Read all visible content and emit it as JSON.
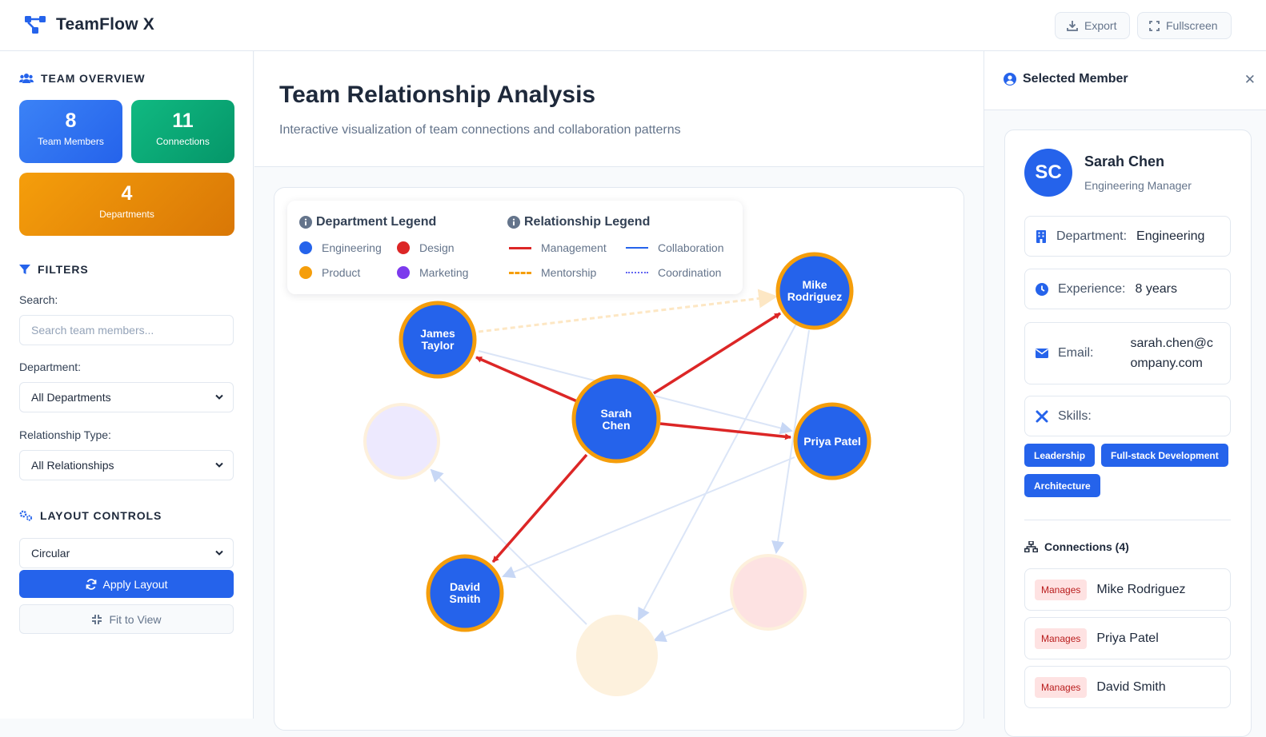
{
  "app": {
    "title": "TeamFlow X"
  },
  "toolbar": {
    "export_label": "Export",
    "fullscreen_label": "Fullscreen"
  },
  "sidebar": {
    "overview_title": "TEAM OVERVIEW",
    "stats": [
      {
        "value": "8",
        "label": "Team Members",
        "color": "#2563eb"
      },
      {
        "value": "11",
        "label": "Connections",
        "color": "#10b981"
      },
      {
        "value": "4",
        "label": "Departments",
        "color": "#f59e0b"
      }
    ],
    "filters_title": "FILTERS",
    "search_label": "Search:",
    "search_placeholder": "Search team members...",
    "department_label": "Department:",
    "department_value": "All Departments",
    "relationship_label": "Relationship Type:",
    "relationship_value": "All Relationships",
    "layout_title": "LAYOUT CONTROLS",
    "layout_value": "Circular",
    "apply_label": "Apply Layout",
    "fit_label": "Fit to View"
  },
  "main": {
    "title": "Team Relationship Analysis",
    "subtitle": "Interactive visualization of team connections and collaboration patterns"
  },
  "legend": {
    "department_title": "Department Legend",
    "relationship_title": "Relationship Legend",
    "departments": [
      {
        "label": "Engineering",
        "color": "#2563eb"
      },
      {
        "label": "Design",
        "color": "#dc2626"
      },
      {
        "label": "Product",
        "color": "#f59e0b"
      },
      {
        "label": "Marketing",
        "color": "#7c3aed"
      }
    ],
    "relationships": [
      {
        "label": "Management",
        "color": "#dc2626",
        "style": "solid-thick"
      },
      {
        "label": "Collaboration",
        "color": "#2563eb",
        "style": "solid"
      },
      {
        "label": "Mentorship",
        "color": "#f59e0b",
        "style": "dashed"
      },
      {
        "label": "Coordination",
        "color": "#6366f1",
        "style": "dotted"
      }
    ]
  },
  "graph": {
    "nodes": [
      {
        "id": "sarah",
        "line1": "Sarah",
        "line2": "Chen",
        "dept": "Engineering",
        "faded": false
      },
      {
        "id": "mike",
        "line1": "Mike",
        "line2": "Rodriguez",
        "dept": "Engineering",
        "faded": false
      },
      {
        "id": "james",
        "line1": "James",
        "line2": "Taylor",
        "dept": "Engineering",
        "faded": false
      },
      {
        "id": "priya",
        "line1": "Priya Patel",
        "line2": "",
        "dept": "Engineering",
        "faded": false
      },
      {
        "id": "david",
        "line1": "David",
        "line2": "Smith",
        "dept": "Engineering",
        "faded": false
      },
      {
        "id": "marketing",
        "line1": "",
        "line2": "",
        "dept": "Marketing",
        "faded": true
      },
      {
        "id": "design",
        "line1": "",
        "line2": "",
        "dept": "Design",
        "faded": true
      },
      {
        "id": "product",
        "line1": "",
        "line2": "",
        "dept": "Product",
        "faded": true
      }
    ]
  },
  "panel": {
    "title": "Selected Member",
    "member": {
      "initials": "SC",
      "name": "Sarah Chen",
      "role": "Engineering Manager",
      "department_key": "Department:",
      "department": "Engineering",
      "experience_key": "Experience:",
      "experience": "8 years",
      "email_key": "Email:",
      "email_line1": "sarah.chen@c",
      "email_line2": "ompany.com",
      "skills_key": "Skills:",
      "skills": [
        "Leadership",
        "Full-stack Development",
        "Architecture"
      ]
    },
    "connections_title": "Connections (4)",
    "connections": [
      {
        "type": "Manages",
        "name": "Mike Rodriguez"
      },
      {
        "type": "Manages",
        "name": "Priya Patel"
      },
      {
        "type": "Manages",
        "name": "David Smith"
      }
    ]
  }
}
